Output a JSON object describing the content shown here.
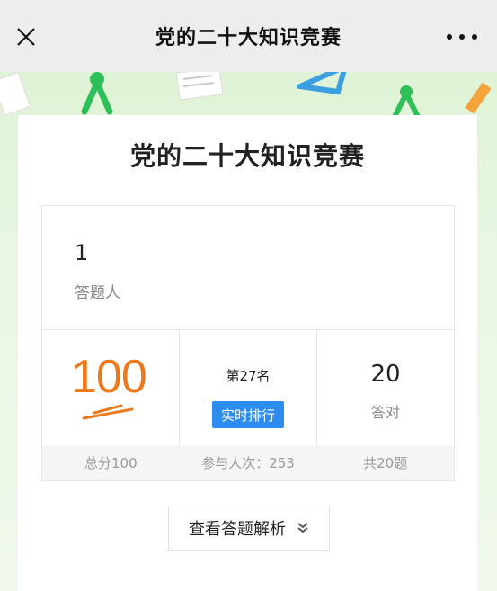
{
  "navbar": {
    "title": "党的二十大知识竞赛",
    "close_icon": "close-icon",
    "more_icon": "more-icon"
  },
  "card": {
    "title": "党的二十大知识竞赛"
  },
  "stats": {
    "respondents_count": "1",
    "respondents_label": "答题人",
    "score": "100",
    "rank": "第27名",
    "rank_button": "实时排行",
    "correct_count": "20",
    "correct_label": "答对",
    "total_score": "总分100",
    "participants": "参与人次：253",
    "question_total": "共20题"
  },
  "review": {
    "label": "查看答题解析",
    "icon": "double-chevron-down-icon"
  },
  "colors": {
    "score": "#ec7a1c",
    "button": "#2d8cf0",
    "background": "#eef7ea"
  }
}
